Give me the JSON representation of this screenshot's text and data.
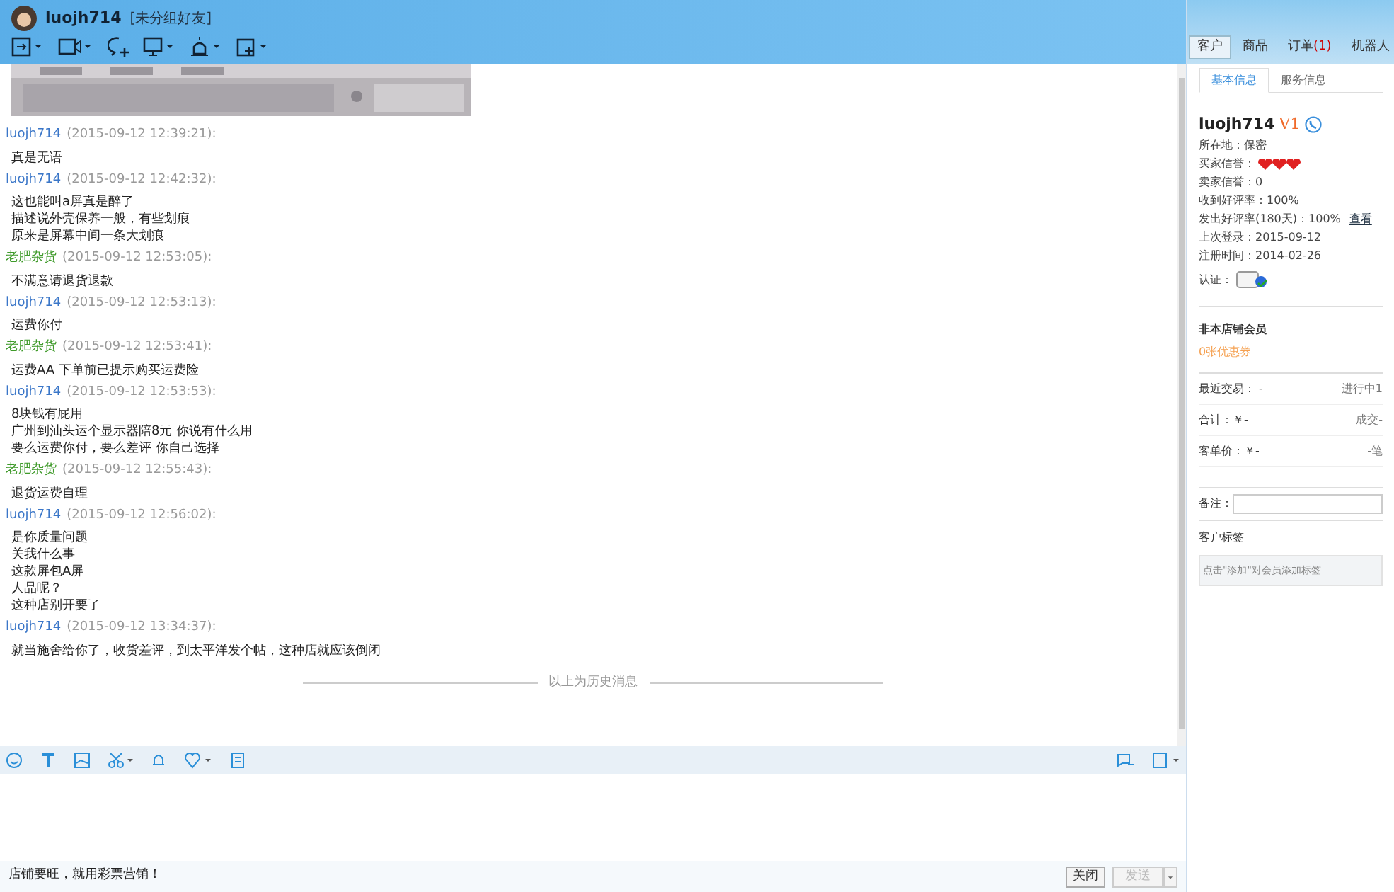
{
  "header": {
    "contact": "luojh714",
    "group": "[未分组好友]"
  },
  "main_tabs": [
    {
      "label": "客户",
      "selected": true
    },
    {
      "label": "商品",
      "selected": false
    },
    {
      "label": "订单",
      "selected": false,
      "badge": "(1)"
    },
    {
      "label": "机器人",
      "selected": false
    }
  ],
  "messages": [
    {
      "sender": "luojh714",
      "kind": "buyer",
      "time": "(2015-09-12 12:39:21):",
      "lines": [
        "真是无语"
      ]
    },
    {
      "sender": "luojh714",
      "kind": "buyer",
      "time": "(2015-09-12 12:42:32):",
      "lines": [
        "这也能叫a屏真是醉了",
        "描述说外壳保养一般，有些划痕",
        "原来是屏幕中间一条大划痕"
      ]
    },
    {
      "sender": "老肥杂货",
      "kind": "seller",
      "time": "(2015-09-12 12:53:05):",
      "lines": [
        "不满意请退货退款"
      ]
    },
    {
      "sender": "luojh714",
      "kind": "buyer",
      "time": "(2015-09-12 12:53:13):",
      "lines": [
        "运费你付"
      ]
    },
    {
      "sender": "老肥杂货",
      "kind": "seller",
      "time": "(2015-09-12 12:53:41):",
      "lines": [
        "运费AA 下单前已提示购买运费险"
      ]
    },
    {
      "sender": "luojh714",
      "kind": "buyer",
      "time": "(2015-09-12 12:53:53):",
      "lines": [
        "8块钱有屁用",
        "广州到汕头运个显示器陪8元 你说有什么用",
        "要么运费你付，要么差评 你自己选择"
      ]
    },
    {
      "sender": "老肥杂货",
      "kind": "seller",
      "time": "(2015-09-12 12:55:43):",
      "lines": [
        "退货运费自理"
      ]
    },
    {
      "sender": "luojh714",
      "kind": "buyer",
      "time": "(2015-09-12 12:56:02):",
      "lines": [
        "是你质量问题",
        "关我什么事",
        "这款屏包A屏",
        "人品呢？",
        "这种店别开要了"
      ]
    },
    {
      "sender": "luojh714",
      "kind": "buyer",
      "time": "(2015-09-12 13:34:37):",
      "lines": [
        "就当施舍给你了，收货差评，到太平洋发个帖，这种店就应该倒闭"
      ]
    }
  ],
  "history_divider": "以上为历史消息",
  "footer": {
    "promo": "店铺要旺，就用彩票营销！",
    "close": "关闭",
    "send": "发送",
    "send_disabled": true
  },
  "info_tabs": [
    {
      "label": "基本信息",
      "selected": true
    },
    {
      "label": "服务信息",
      "selected": false
    }
  ],
  "profile": {
    "name": "luojh714",
    "level": "V1",
    "fields": [
      {
        "label": "所在地：保密"
      },
      {
        "label": "买家信誉：",
        "kind": "hearts"
      },
      {
        "label": "卖家信誉：0"
      },
      {
        "label": "收到好评率：100%"
      },
      {
        "label": "发出好评率(180天)：100%",
        "link": "查看"
      },
      {
        "label": "上次登录：2015-09-12"
      },
      {
        "label": "注册时间：2014-02-26"
      },
      {
        "label": "认证："
      }
    ]
  },
  "membership": {
    "title": "非本店铺会员",
    "coupons": "0张优惠券"
  },
  "stats": [
    {
      "left": "最近交易： -",
      "right": "进行中1"
    },
    {
      "left": "合计：￥-",
      "right": "成交-"
    },
    {
      "left": "客单价：￥-",
      "right": "-笔"
    }
  ],
  "note_label": "备注：",
  "tags": {
    "title": "客户标签",
    "hint": "点击\"添加\"对会员添加标签"
  }
}
